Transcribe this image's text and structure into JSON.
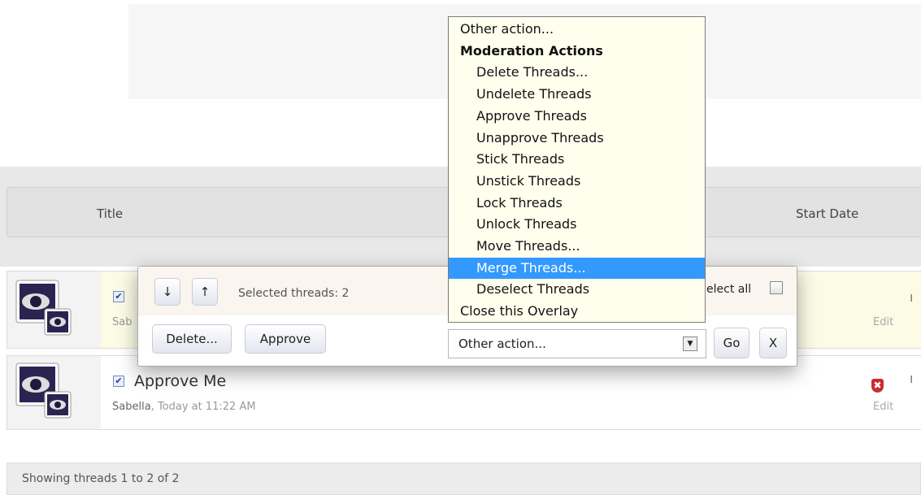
{
  "header": {
    "title_col": "Title",
    "start_date_col": "Start Date"
  },
  "threads": [
    {
      "title": "",
      "author": "Sab",
      "edit_label": "Edit",
      "checked": true
    },
    {
      "title": "Approve Me",
      "author": "Sabella",
      "time": "Today at 11:22 AM",
      "edit_label": "Edit",
      "checked": true
    }
  ],
  "footer": {
    "text": "Showing threads 1 to 2 of 2"
  },
  "overlay": {
    "down_label": "↓",
    "up_label": "↑",
    "selected_label": "Selected threads: 2",
    "select_all_label": "elect all",
    "delete_label": "Delete...",
    "approve_label": "Approve",
    "select_value": "Other action...",
    "go_label": "Go",
    "close_label": "X"
  },
  "dropdown": {
    "items": [
      {
        "label": "Other action...",
        "kind": "top"
      },
      {
        "label": "Moderation Actions",
        "kind": "group"
      },
      {
        "label": "Delete Threads...",
        "kind": "sub"
      },
      {
        "label": "Undelete Threads",
        "kind": "sub"
      },
      {
        "label": "Approve Threads",
        "kind": "sub"
      },
      {
        "label": "Unapprove Threads",
        "kind": "sub"
      },
      {
        "label": "Stick Threads",
        "kind": "sub"
      },
      {
        "label": "Unstick Threads",
        "kind": "sub"
      },
      {
        "label": "Lock Threads",
        "kind": "sub"
      },
      {
        "label": "Unlock Threads",
        "kind": "sub"
      },
      {
        "label": "Move Threads...",
        "kind": "sub"
      },
      {
        "label": "Merge Threads...",
        "kind": "sub",
        "selected": true
      },
      {
        "label": "Deselect Threads",
        "kind": "sub"
      },
      {
        "label": "Close this Overlay",
        "kind": "top"
      }
    ]
  },
  "colors": {
    "selected_option": "#3399ff",
    "dropdown_bg": "#ffffee",
    "unapproved_row": "#fbfbe6"
  }
}
